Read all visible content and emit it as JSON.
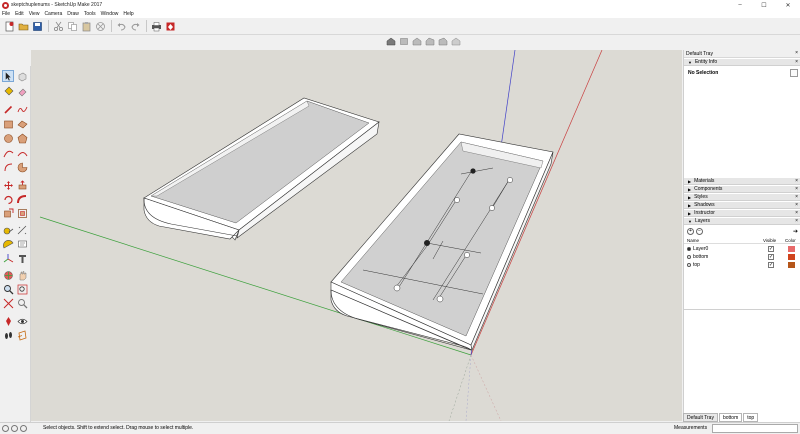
{
  "window": {
    "title": "skeptchuplenums - SketchUp Make 2017"
  },
  "window_controls": [
    "–",
    "☐",
    "✕"
  ],
  "menus": [
    "File",
    "Edit",
    "View",
    "Camera",
    "Draw",
    "Tools",
    "Window",
    "Help"
  ],
  "tray": {
    "title": "Default Tray",
    "close": "×",
    "entity_info": {
      "header": "Entity Info",
      "selection": "No Selection"
    },
    "panels": [
      "Materials",
      "Components",
      "Styles",
      "Shadows",
      "Instructor"
    ],
    "layers": {
      "header": "Layers",
      "columns": {
        "name": "Name",
        "visible": "Visible",
        "color": "Color"
      },
      "rows": [
        {
          "name": "Layer0",
          "active": true,
          "visible": true,
          "color": "#e86a6a"
        },
        {
          "name": "bottom",
          "active": false,
          "visible": true,
          "color": "#d0431c"
        },
        {
          "name": "top",
          "active": false,
          "visible": true,
          "color": "#b5561a"
        }
      ]
    },
    "tabs": [
      "Default Tray",
      "bottom",
      "top"
    ]
  },
  "status": {
    "message": "Select objects. Shift to extend select. Drag mouse to select multiple.",
    "measurements_label": "Measurements"
  },
  "colors": {
    "viewport": "#dcdad4",
    "axis_red": "#c84040",
    "axis_green": "#3ca03c",
    "axis_blue": "#4040c8",
    "tray_face": "#ffffff"
  }
}
